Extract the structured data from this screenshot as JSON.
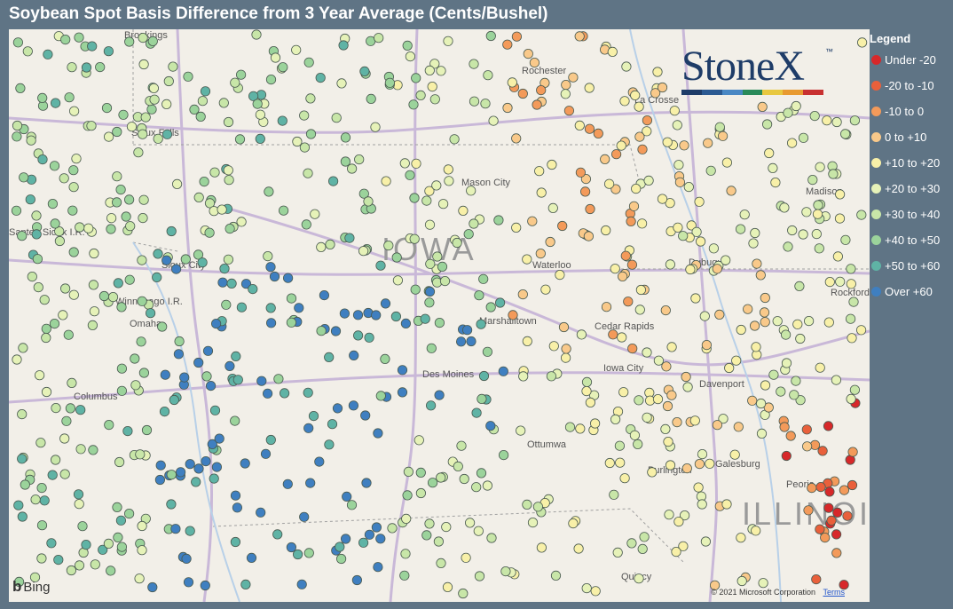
{
  "title": "Soybean Spot Basis Difference from 3 Year Average (Cents/Bushel)",
  "legend": {
    "title": "Legend",
    "items": [
      {
        "label": "Under -20",
        "color": "#d7282a"
      },
      {
        "label": "-20 to -10",
        "color": "#e9603b"
      },
      {
        "label": "-10 to 0",
        "color": "#f39a5a"
      },
      {
        "label": "0 to +10",
        "color": "#f9c98a"
      },
      {
        "label": "+10 to +20",
        "color": "#f8f0a8"
      },
      {
        "label": "+20 to +30",
        "color": "#e6f2b8"
      },
      {
        "label": "+30 to +40",
        "color": "#c8e6a8"
      },
      {
        "label": "+40 to +50",
        "color": "#9bd39b"
      },
      {
        "label": "+50 to +60",
        "color": "#5fb3a5"
      },
      {
        "label": "Over +60",
        "color": "#3f7fc0"
      }
    ]
  },
  "logo": {
    "text": "StoneX",
    "tm": "™",
    "bar_colors": [
      "#1e3c68",
      "#2c5a92",
      "#4a88c4",
      "#2a8a5a",
      "#e8c840",
      "#e89a30",
      "#c83030"
    ]
  },
  "map": {
    "states": [
      "IOWA",
      "ILLINOIS"
    ],
    "places": [
      "Brookings",
      "Rochester",
      "La Crosse",
      "Sioux Falls",
      "Mason City",
      "Madison",
      "Santee Sioux I.R.",
      "Sioux City",
      "Waterloo",
      "Dubuque",
      "Rockford",
      "Winnebago I.R.",
      "Omaha",
      "Marshalltown",
      "Cedar Rapids",
      "Iowa City",
      "Des Moines",
      "Davenport",
      "Columbus",
      "Ottumwa",
      "Galesburg",
      "Burlington",
      "Peoria",
      "Quincy"
    ],
    "attribution": "Bing",
    "copyright": "© 2021 Microsoft Corporation",
    "terms": "Terms"
  }
}
